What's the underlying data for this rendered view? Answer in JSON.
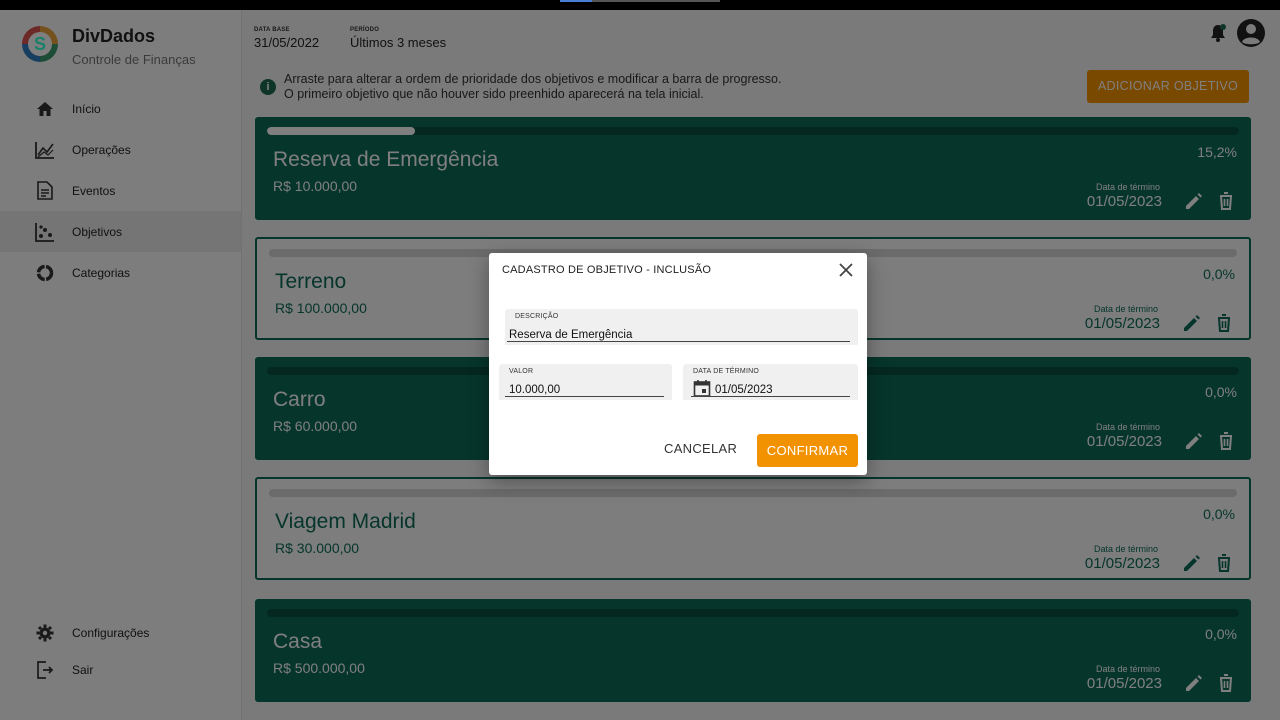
{
  "app": {
    "name": "DivDados",
    "subtitle": "Controle de Finanças",
    "logo_letter": "S"
  },
  "sidebar": {
    "items": [
      {
        "label": "Início",
        "icon": "home-icon"
      },
      {
        "label": "Operações",
        "icon": "chart-line-icon"
      },
      {
        "label": "Eventos",
        "icon": "document-icon"
      },
      {
        "label": "Objetivos",
        "icon": "scatter-icon",
        "active": true
      },
      {
        "label": "Categorias",
        "icon": "donut-icon"
      }
    ],
    "bottom_items": [
      {
        "label": "Configurações",
        "icon": "gear-icon"
      },
      {
        "label": "Sair",
        "icon": "logout-icon"
      }
    ]
  },
  "header": {
    "data_base_label": "DATA BASE",
    "data_base_value": "31/05/2022",
    "periodo_label": "PERÍODO",
    "periodo_value": "Últimos 3 meses"
  },
  "info": {
    "line1": "Arraste para alterar a ordem de prioridade dos objetivos e modificar a barra de progresso.",
    "line2": "O primeiro objetivo que não houver sido preenhido aparecerá na tela inicial."
  },
  "add_button_label": "ADICIONAR OBJETIVO",
  "objectives": [
    {
      "name": "Reserva de Emergência",
      "amount": "R$ 10.000,00",
      "percent": "15,2%",
      "progress": 0.152,
      "end_label": "Data de término",
      "end_date": "01/05/2023",
      "style": "dark"
    },
    {
      "name": "Terreno",
      "amount": "R$ 100.000,00",
      "percent": "0,0%",
      "progress": 0.0,
      "end_label": "Data de término",
      "end_date": "01/05/2023",
      "style": "light"
    },
    {
      "name": "Carro",
      "amount": "R$ 60.000,00",
      "percent": "0,0%",
      "progress": 0.0,
      "end_label": "Data de término",
      "end_date": "01/05/2023",
      "style": "dark"
    },
    {
      "name": "Viagem Madrid",
      "amount": "R$ 30.000,00",
      "percent": "0,0%",
      "progress": 0.0,
      "end_label": "Data de término",
      "end_date": "01/05/2023",
      "style": "light"
    },
    {
      "name": "Casa",
      "amount": "R$ 500.000,00",
      "percent": "0,0%",
      "progress": 0.0,
      "end_label": "Data de término",
      "end_date": "01/05/2023",
      "style": "dark"
    }
  ],
  "dialog": {
    "title": "CADASTRO DE OBJETIVO - INCLUSÃO",
    "descricao_label": "DESCRIÇÃO",
    "descricao_value": "Reserva de Emergência",
    "valor_label": "VALOR",
    "valor_value": "10.000,00",
    "data_label": "DATA DE TÉRMINO",
    "data_value": "01/05/2023",
    "cancel_label": "CANCELAR",
    "confirm_label": "CONFIRMAR"
  },
  "colors": {
    "primary": "#0d6b57",
    "accent": "#f39200"
  }
}
